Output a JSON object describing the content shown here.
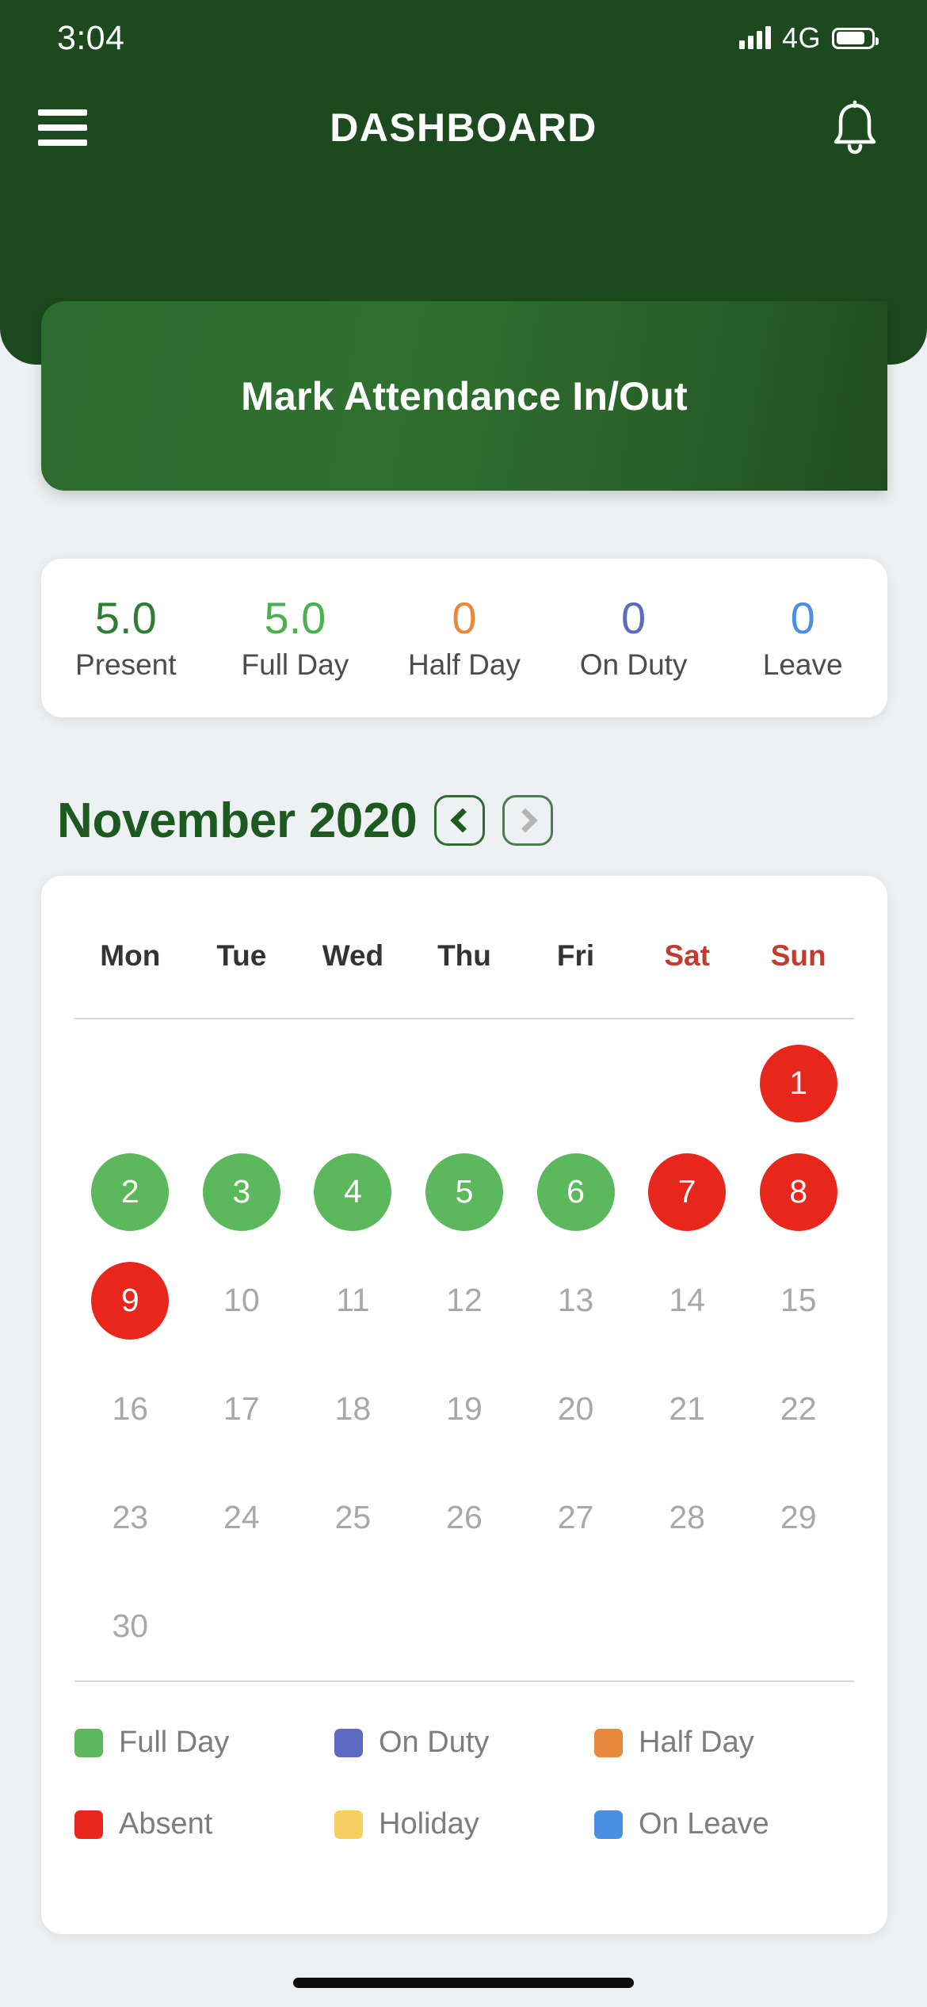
{
  "status_bar": {
    "time": "3:04",
    "network": "4G",
    "signal_icon": "signal-bars-icon",
    "battery_icon": "battery-icon"
  },
  "nav": {
    "menu_icon": "hamburger-menu-icon",
    "title": "DASHBOARD",
    "notification_icon": "bell-icon"
  },
  "attendance_banner": {
    "label": "Mark Attendance In/Out"
  },
  "stats": [
    {
      "value": "5.0",
      "label": "Present",
      "color": "#2e7d32"
    },
    {
      "value": "5.0",
      "label": "Full Day",
      "color": "#4caf50"
    },
    {
      "value": "0",
      "label": "Half Day",
      "color": "#e8883a"
    },
    {
      "value": "0",
      "label": "On Duty",
      "color": "#5c6bc0"
    },
    {
      "value": "0",
      "label": "Leave",
      "color": "#4a90e2"
    }
  ],
  "calendar": {
    "month": "November",
    "year": "2020",
    "title": "November  2020",
    "prev_icon": "chevron-left-icon",
    "next_icon": "chevron-right-icon",
    "prev_enabled": true,
    "next_enabled": false,
    "weekdays": [
      {
        "label": "Mon",
        "weekend": false
      },
      {
        "label": "Tue",
        "weekend": false
      },
      {
        "label": "Wed",
        "weekend": false
      },
      {
        "label": "Thu",
        "weekend": false
      },
      {
        "label": "Fri",
        "weekend": false
      },
      {
        "label": "Sat",
        "weekend": true
      },
      {
        "label": "Sun",
        "weekend": true
      }
    ],
    "leading_blanks": 6,
    "days": [
      {
        "day": "1",
        "status": "absent"
      },
      {
        "day": "2",
        "status": "full"
      },
      {
        "day": "3",
        "status": "full"
      },
      {
        "day": "4",
        "status": "full"
      },
      {
        "day": "5",
        "status": "full"
      },
      {
        "day": "6",
        "status": "full"
      },
      {
        "day": "7",
        "status": "absent"
      },
      {
        "day": "8",
        "status": "absent"
      },
      {
        "day": "9",
        "status": "absent"
      },
      {
        "day": "10",
        "status": "none"
      },
      {
        "day": "11",
        "status": "none"
      },
      {
        "day": "12",
        "status": "none"
      },
      {
        "day": "13",
        "status": "none"
      },
      {
        "day": "14",
        "status": "none"
      },
      {
        "day": "15",
        "status": "none"
      },
      {
        "day": "16",
        "status": "none"
      },
      {
        "day": "17",
        "status": "none"
      },
      {
        "day": "18",
        "status": "none"
      },
      {
        "day": "19",
        "status": "none"
      },
      {
        "day": "20",
        "status": "none"
      },
      {
        "day": "21",
        "status": "none"
      },
      {
        "day": "22",
        "status": "none"
      },
      {
        "day": "23",
        "status": "none"
      },
      {
        "day": "24",
        "status": "none"
      },
      {
        "day": "25",
        "status": "none"
      },
      {
        "day": "26",
        "status": "none"
      },
      {
        "day": "27",
        "status": "none"
      },
      {
        "day": "28",
        "status": "none"
      },
      {
        "day": "29",
        "status": "none"
      },
      {
        "day": "30",
        "status": "none"
      }
    ]
  },
  "legend": [
    {
      "label": "Full Day",
      "color": "#5cb85c"
    },
    {
      "label": "On Duty",
      "color": "#5c6bc0"
    },
    {
      "label": "Half Day",
      "color": "#e8883a"
    },
    {
      "label": "Absent",
      "color": "#e8271c"
    },
    {
      "label": "Holiday",
      "color": "#f5cf5f"
    },
    {
      "label": "On Leave",
      "color": "#4a90e2"
    }
  ]
}
